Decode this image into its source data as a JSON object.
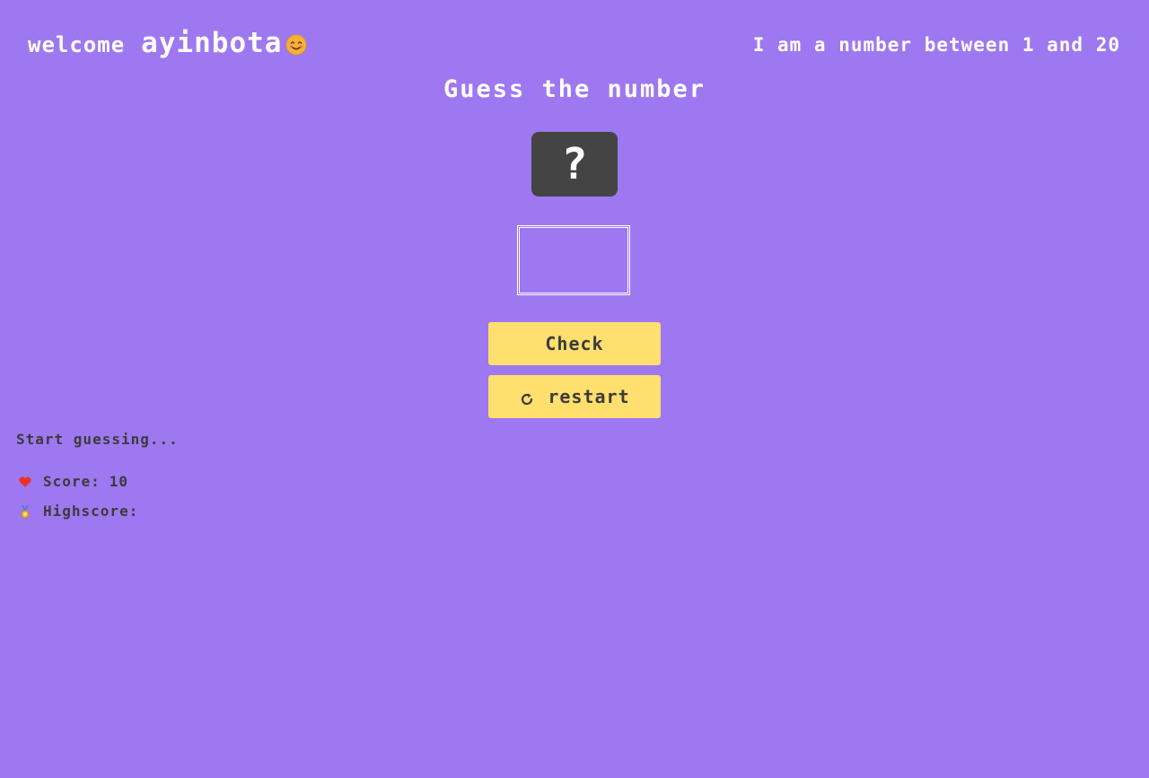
{
  "header": {
    "welcome_word": "welcome",
    "username": "ayinbota",
    "hint": "I am a number between 1 and 20"
  },
  "game": {
    "title": "Guess the number",
    "secret_display": "?",
    "guess_value": "",
    "check_label": "Check",
    "restart_label": "restart",
    "message": "Start guessing...",
    "score_label": "Score:",
    "score_value": "10",
    "highscore_label": "Highscore:",
    "highscore_value": ""
  },
  "icons": {
    "smiley": "smiling-face-icon",
    "restart": "restart-icon",
    "score": "heart-icon",
    "highscore": "medal-icon"
  },
  "colors": {
    "background": "#9e78f0",
    "button": "#ffdf6e",
    "secret_box": "#444444",
    "text_dark": "#3b3b3b",
    "text_light": "#ffffff",
    "heart": "#e8332a"
  }
}
